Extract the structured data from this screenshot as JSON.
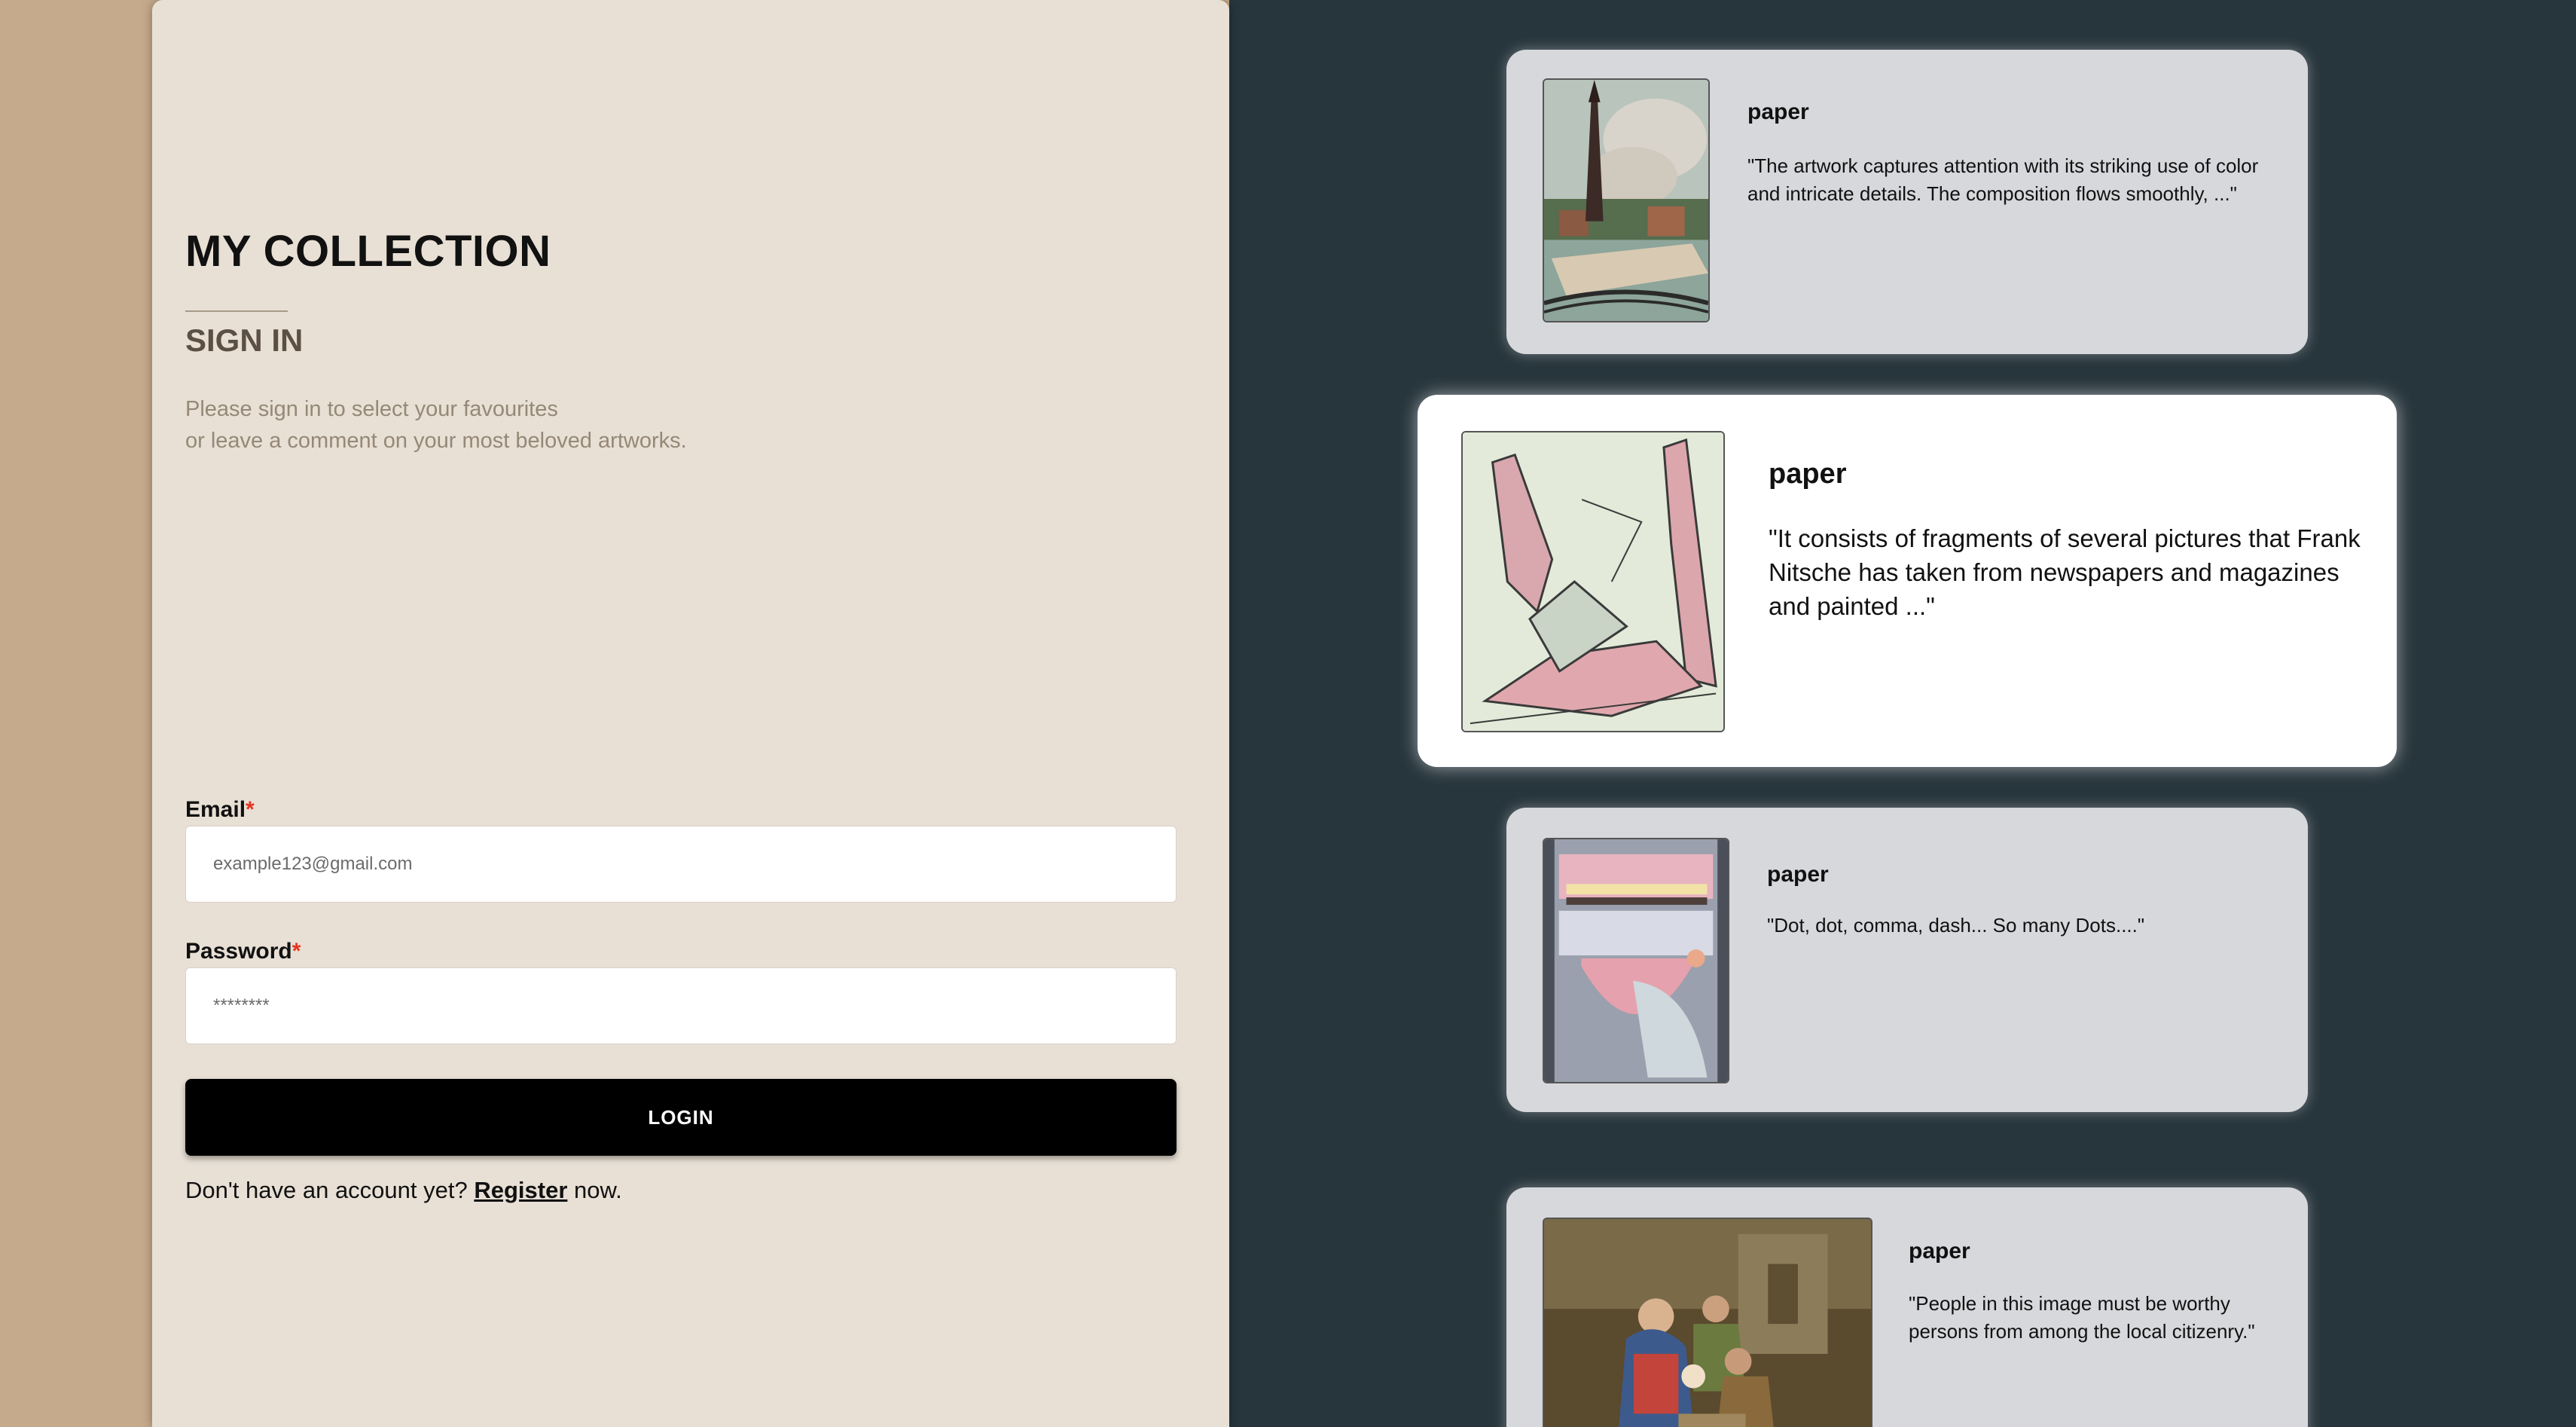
{
  "auth": {
    "app_title": "MY COLLECTION",
    "heading": "SIGN IN",
    "subtitle_line1": "Please sign in to select your favourites",
    "subtitle_line2": "or leave a comment on your most beloved artworks.",
    "email_label": "Email",
    "email_placeholder": "example123@gmail.com",
    "password_label": "Password",
    "password_placeholder": "********",
    "required_mark": "*",
    "login_label": "LOGIN",
    "register_prefix": "Don't have an account yet? ",
    "register_link": "Register",
    "register_suffix": " now."
  },
  "artworks": [
    {
      "title": "paper",
      "description": "\"The artwork captures attention with its striking use of color and intricate details. The composition flows smoothly, ...\"",
      "thumbnail_icon": "church-townscape-painting"
    },
    {
      "title": "paper",
      "description": "\"It consists of fragments of several pictures that Frank Nitsche has taken from newspapers and magazines and painted ...\"",
      "thumbnail_icon": "pink-abstract-shapes-painting"
    },
    {
      "title": "paper",
      "description": "\"Dot, dot, comma, dash... So many Dots....\"",
      "thumbnail_icon": "abstract-face-painting"
    },
    {
      "title": "paper",
      "description": "\"People in this image must be worthy persons from among the local citizenry.\"",
      "thumbnail_icon": "nativity-scene-painting"
    }
  ],
  "colors": {
    "page_left_bg": "#c6aa8c",
    "panel_bg": "#e8e0d5",
    "page_right_bg": "#27353c",
    "card_bg": "#d7d8db",
    "card_active_bg": "#ffffff",
    "required": "#e5331f",
    "login_bg": "#000000"
  }
}
